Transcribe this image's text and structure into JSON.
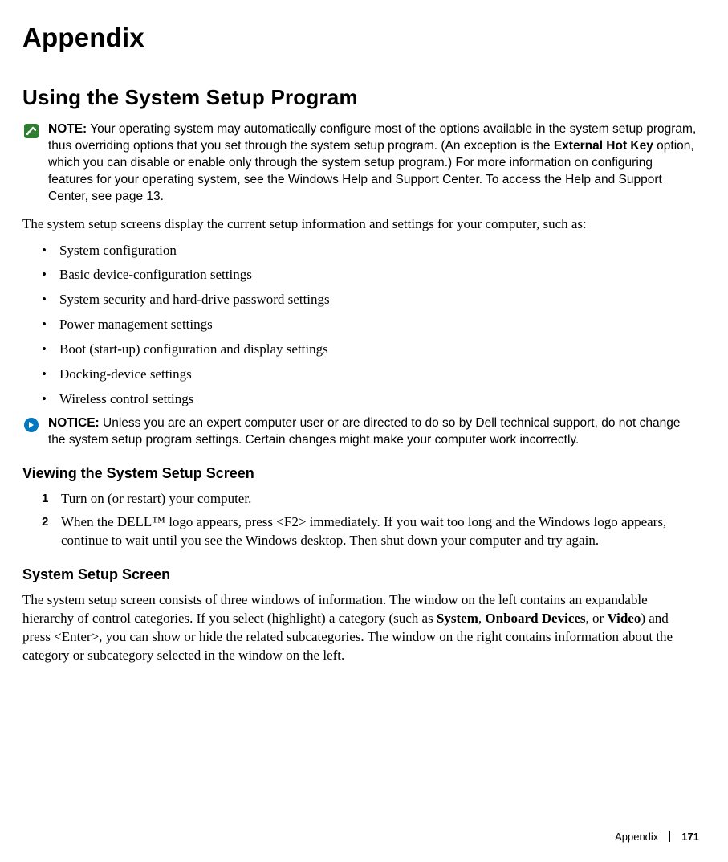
{
  "title": "Appendix",
  "section_heading": "Using the System Setup Program",
  "note": {
    "label": "NOTE:",
    "text_before": " Your operating system may automatically configure most of the options available in the system setup program, thus overriding options that you set through the system setup program. (An exception is the ",
    "bold1": "External Hot Key",
    "text_after": " option, which you can disable or enable only through the system setup program.) For more information on configuring features for your operating system, see the Windows Help and Support Center. To access the Help and Support Center, see page 13."
  },
  "intro_paragraph": "The system setup screens display the current setup information and settings for your computer, such as:",
  "bullets": [
    "System configuration",
    "Basic device-configuration settings",
    "System security and hard-drive password settings",
    "Power management settings",
    "Boot (start-up) configuration and display settings",
    "Docking-device settings",
    "Wireless control settings"
  ],
  "notice": {
    "label": "NOTICE:",
    "text": " Unless you are an expert computer user or are directed to do so by Dell technical support, do not change the system setup program settings. Certain changes might make your computer work incorrectly."
  },
  "viewing": {
    "heading": "Viewing the System Setup Screen",
    "steps": [
      "Turn on (or restart) your computer.",
      "When the DELL™ logo appears, press <F2> immediately. If you wait too long and the Windows logo appears, continue to wait until you see the Windows desktop. Then shut down your computer and try again."
    ]
  },
  "screen": {
    "heading": "System Setup Screen",
    "p_before": "The system setup screen consists of three windows of information. The window on the left contains an expandable hierarchy of control categories. If you select (highlight) a category (such as ",
    "b1": "System",
    "sep1": ", ",
    "b2": "Onboard Devices",
    "sep2": ", or ",
    "b3": "Video",
    "p_after": ") and press <Enter>, you can show or hide the related subcategories. The window on the right contains information about the category or subcategory selected in the window on the left."
  },
  "footer": {
    "label": "Appendix",
    "page": "171"
  }
}
